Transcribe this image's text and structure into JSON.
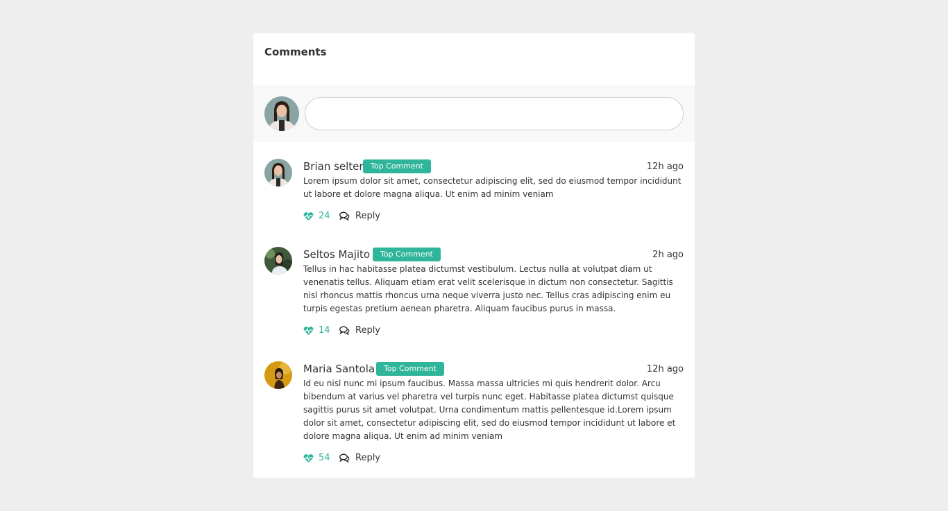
{
  "card": {
    "title": "Comments"
  },
  "composer": {
    "value": "",
    "placeholder": ""
  },
  "comments": [
    {
      "author": "Brian selter",
      "badge": "Top Comment",
      "time": "12h ago",
      "text": "Lorem ipsum dolor sit amet, consectetur adipiscing elit, sed do eiusmod tempor incididunt ut labore et dolore magna aliqua. Ut enim ad minim veniam",
      "likes": "24",
      "reply_label": "Reply"
    },
    {
      "author": "Seltos Majito",
      "badge": "Top Comment",
      "time": "2h ago",
      "text": "Tellus in hac habitasse platea dictumst vestibulum. Lectus nulla at volutpat diam ut venenatis tellus. Aliquam etiam erat velit scelerisque in dictum non consectetur. Sagittis nisl rhoncus mattis rhoncus urna neque viverra justo nec. Tellus cras adipiscing enim eu turpis egestas pretium aenean pharetra. Aliquam faucibus purus in massa.",
      "likes": "14",
      "reply_label": "Reply"
    },
    {
      "author": "Maria Santola",
      "badge": "Top Comment",
      "time": "12h ago",
      "text": "Id eu nisl nunc mi ipsum faucibus. Massa massa ultricies mi quis hendrerit dolor. Arcu bibendum at varius vel pharetra vel turpis nunc eget. Habitasse platea dictumst quisque sagittis purus sit amet volutpat. Urna condimentum mattis pellentesque id.Lorem ipsum dolor sit amet, consectetur adipiscing elit, sed do eiusmod tempor incididunt ut labore et dolore magna aliqua. Ut enim ad minim veniam",
      "likes": "54",
      "reply_label": "Reply"
    }
  ],
  "colors": {
    "accent": "#2fb59a",
    "background": "#eeeeee",
    "card": "#ffffff"
  },
  "icons": {
    "like": "heartbeat-icon",
    "reply": "comments-icon"
  }
}
